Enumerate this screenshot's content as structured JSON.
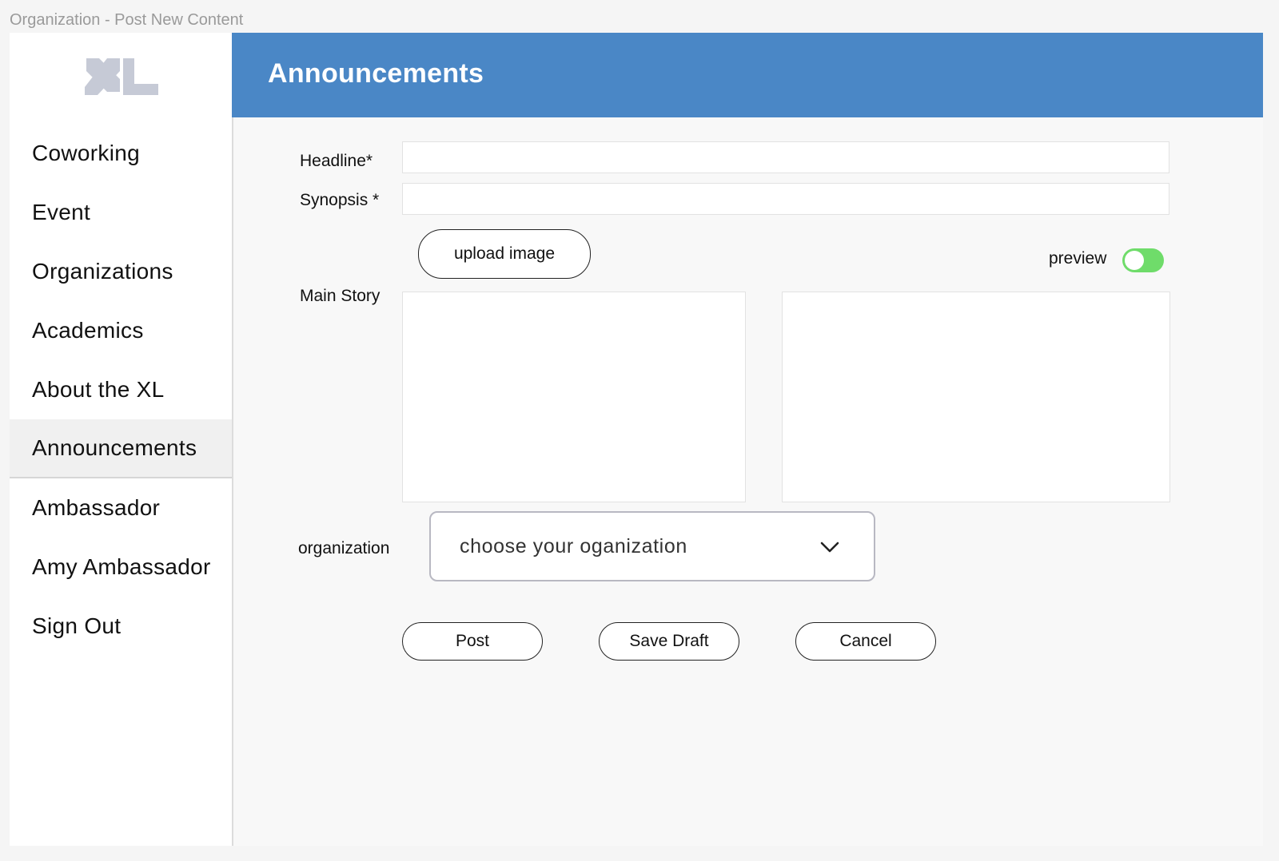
{
  "window": {
    "title": "Organization - Post New Content"
  },
  "sidebar": {
    "logo": "XL logo",
    "items": [
      {
        "label": "Coworking"
      },
      {
        "label": "Event"
      },
      {
        "label": "Organizations"
      },
      {
        "label": "Academics"
      },
      {
        "label": "About the XL"
      },
      {
        "label": "Announcements",
        "active": true
      },
      {
        "label": "Ambassador"
      },
      {
        "label": "Amy Ambassador"
      },
      {
        "label": "Sign Out"
      }
    ]
  },
  "header": {
    "title": "Announcements",
    "color": "#4a87c6"
  },
  "form": {
    "headline_label": "Headline*",
    "headline_value": "",
    "synopsis_label": "Synopsis *",
    "synopsis_value": "",
    "upload_image_label": "upload image",
    "preview_label": "preview",
    "preview_on": true,
    "main_story_label": "Main Story",
    "main_story_value": "",
    "preview_pane_value": "",
    "organization_label": "organization",
    "organization_placeholder": "choose your oganization",
    "post_label": "Post",
    "save_draft_label": "Save Draft",
    "cancel_label": "Cancel"
  },
  "colors": {
    "accent": "#4a87c6",
    "toggle_on": "#6fdc6a",
    "logo": "#c6cad6"
  },
  "icons": {
    "logo": "xl-logo",
    "dropdown": "chevron-down-icon"
  }
}
